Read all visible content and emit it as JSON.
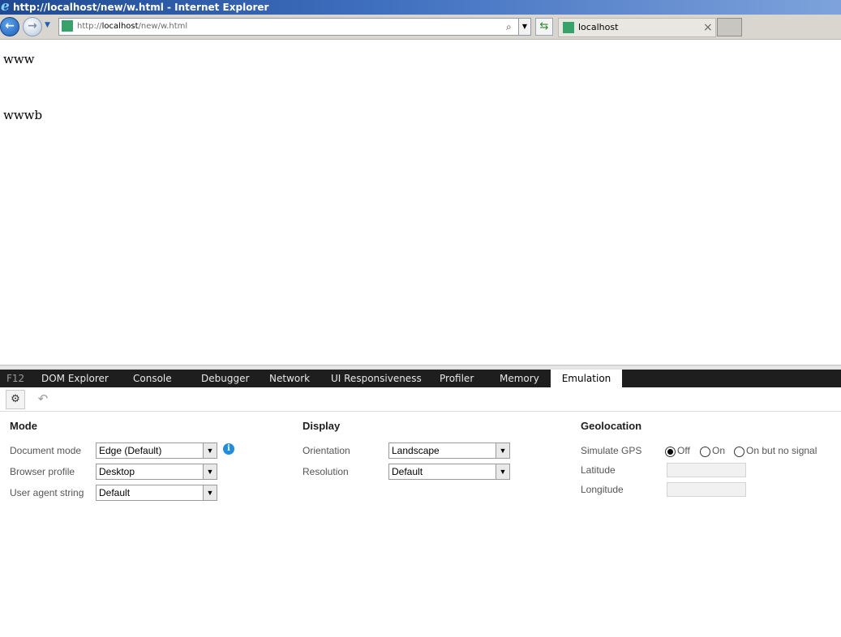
{
  "window": {
    "title": "http://localhost/new/w.html - Internet Explorer"
  },
  "navbar": {
    "address_prefix": "http://",
    "address_host": "localhost",
    "address_path": "/new/w.html",
    "tab_label": "localhost"
  },
  "page": {
    "line1": "www",
    "line2": "wwwb"
  },
  "devtools": {
    "tabs": [
      "F12",
      "DOM Explorer",
      "Console",
      "Debugger",
      "Network",
      "UI Responsiveness",
      "Profiler",
      "Memory",
      "Emulation"
    ],
    "active_tab": "Emulation",
    "mode": {
      "title": "Mode",
      "document_mode_label": "Document mode",
      "document_mode_value": "Edge (Default)",
      "browser_profile_label": "Browser profile",
      "browser_profile_value": "Desktop",
      "user_agent_label": "User agent string",
      "user_agent_value": "Default"
    },
    "display": {
      "title": "Display",
      "orientation_label": "Orientation",
      "orientation_value": "Landscape",
      "resolution_label": "Resolution",
      "resolution_value": "Default"
    },
    "geolocation": {
      "title": "Geolocation",
      "simulate_gps_label": "Simulate GPS",
      "options": [
        "Off",
        "On",
        "On but no signal"
      ],
      "selected": "Off",
      "latitude_label": "Latitude",
      "longitude_label": "Longitude"
    }
  },
  "colors": {
    "title_bar": "#1f4a93",
    "devtools_tabbar": "#1e1e1e",
    "info_icon": "#1f8ee0",
    "favicon": "#36a36a"
  }
}
